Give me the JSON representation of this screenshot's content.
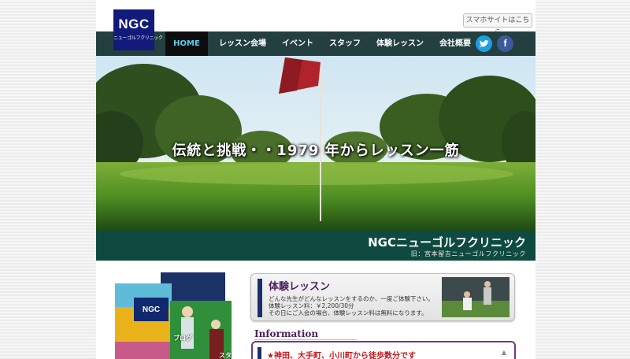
{
  "header": {
    "logo_main": "NGC",
    "logo_sub": "ニューゴルフクリニック",
    "sp_link": "スマホサイトはこちら"
  },
  "nav": {
    "items": [
      "HOME",
      "レッスン会場",
      "イベント",
      "スタッフ",
      "体験レッスン",
      "会社概要"
    ],
    "active_color": "#4fd2f0",
    "bar_color": "#243f40"
  },
  "social": {
    "twitter": "twitter-icon",
    "facebook": "facebook-icon"
  },
  "hero": {
    "tagline": "伝統と挑戦・・1979 年からレッスン一筋",
    "band_title": "NGCニューゴルフクリニック",
    "band_sub": "旧：宮本留吉ニューゴルフクリニック"
  },
  "cards": {
    "blog": "ブログ",
    "staff": "スタッフ"
  },
  "trial": {
    "title": "体験レッスン",
    "line1": "どんな先生がどんなレッスンをするのか、一度ご体験下さい。",
    "line2": "体験レッスン料：￥2,200/30分",
    "line3": "その日にご入会の場合、体験レッスン料は無料になります。"
  },
  "information": {
    "title": "Information",
    "item1": "★神田、大手町、小川町から徒歩数分です",
    "arrow": "▲"
  }
}
